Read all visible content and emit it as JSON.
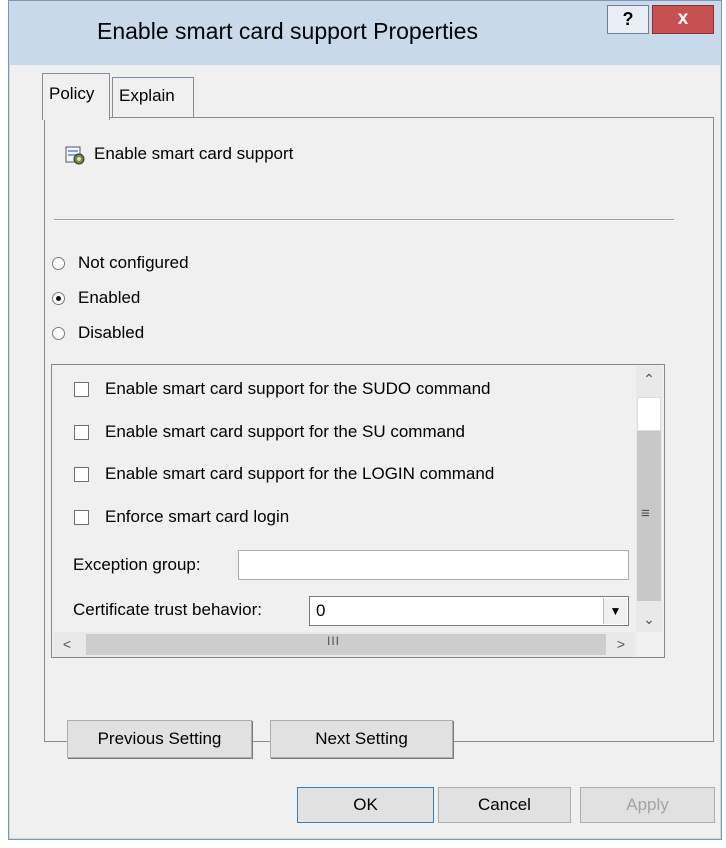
{
  "window": {
    "title": "Enable smart card support Properties",
    "help_label": "?",
    "close_label": "x"
  },
  "tabs": [
    {
      "label": "Policy",
      "selected": true
    },
    {
      "label": "Explain",
      "selected": false
    }
  ],
  "policy": {
    "name": "Enable smart card support",
    "icon": "policy-settings-icon"
  },
  "state": {
    "options": [
      {
        "label": "Not configured",
        "selected": false
      },
      {
        "label": "Enabled",
        "selected": true
      },
      {
        "label": "Disabled",
        "selected": false
      }
    ]
  },
  "options_panel": {
    "checkboxes": [
      {
        "label": "Enable smart card support for the SUDO command",
        "checked": false
      },
      {
        "label": "Enable smart card support for the SU command",
        "checked": false
      },
      {
        "label": "Enable smart card support for the LOGIN command",
        "checked": false
      },
      {
        "label": "Enforce smart card login",
        "checked": false
      }
    ],
    "exception_group_label": "Exception group:",
    "exception_group_value": "",
    "cert_trust_label": "Certificate trust behavior:",
    "cert_trust_value": "0"
  },
  "nav": {
    "previous_label": "Previous Setting",
    "next_label": "Next Setting"
  },
  "footer": {
    "ok_label": "OK",
    "cancel_label": "Cancel",
    "apply_label": "Apply"
  }
}
